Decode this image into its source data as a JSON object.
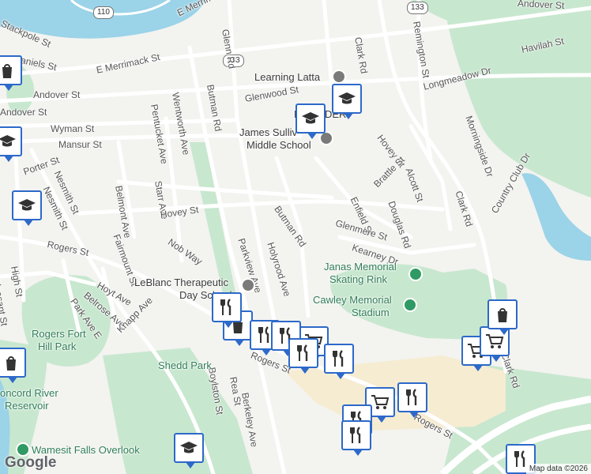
{
  "map": {
    "attribution": "Map data ©2026",
    "logo": "Google",
    "colors": {
      "water": "#9bd3e8",
      "park": "#c8e7cf",
      "highway": "#ffffff",
      "land": "#f3f3f0",
      "pin_border": "#2c69c9"
    }
  },
  "route_shields": [
    "110",
    "133",
    "133"
  ],
  "street_labels": [
    "Andover St",
    "Stackpole St",
    "E Merrimack St",
    "E Merrimack St",
    "Daniels St",
    "Glenn Rd",
    "Clark Rd",
    "Remington St",
    "Havilah St",
    "Glenwood St",
    "Longmeadow Dr",
    "Morningside Dr",
    "Wyman St",
    "Mansur St",
    "Pentucket Ave",
    "Wentworth Ave",
    "Butman Rd",
    "Porter St",
    "Nesmith St",
    "Belmont Ave",
    "Starr Ave",
    "Hovey St",
    "Hovey St",
    "Alcott St",
    "Brattle St",
    "Enfield St",
    "Douglas Rd",
    "Butman Rd",
    "Glenmere St",
    "Clark Rd",
    "Country Club Dr",
    "Nob Way",
    "Fairmount St",
    "Rogers St",
    "Kearney Dr",
    "Parkview Ave",
    "Holyrood Ave",
    "High St",
    "Pleasant St",
    "Hoyt Ave",
    "Belrose Ave",
    "Park Ave E",
    "Knapp Ave",
    "Rogers St",
    "Boylston St",
    "Rea St",
    "Berkeley Ave",
    "Rogers St",
    "Andover St",
    "Andover St",
    "Clark Rd",
    "Nesmith St"
  ],
  "poi_labels": {
    "learning_latta": "Learning Latta",
    "school": "James Sullivan Middle School",
    "school_line1": "James Sulliv",
    "school_line2": "Middle School",
    "bartlett": "B",
    "bartlett2": "DER",
    "rink_line1": "Janas Memorial",
    "rink_line2": "Skating Rink",
    "stadium_line1": "Cawley Memorial",
    "stadium_line2": "Stadium",
    "leblanc_line1": "LeBlanc Therapeutic",
    "leblanc_line2": "Day School",
    "rogers_fort_line1": "Rogers Fort",
    "rogers_fort_line2": "Hill Park",
    "shedd_park": "Shedd Park",
    "concord_line1": "oncord River",
    "concord_line2": "Reservoir",
    "wamesit": "Wamesit Falls Overlook"
  },
  "markers": [
    "bag",
    "school",
    "school",
    "school",
    "school",
    "school",
    "bag",
    "bag",
    "fork-knife",
    "fork-knife",
    "cart",
    "fork-knife",
    "fork-knife",
    "fork-knife",
    "cart",
    "fork-knife",
    "fork-knife",
    "fork-knife",
    "cart",
    "school",
    "fork-knife",
    "bag",
    "cart",
    "cart"
  ]
}
